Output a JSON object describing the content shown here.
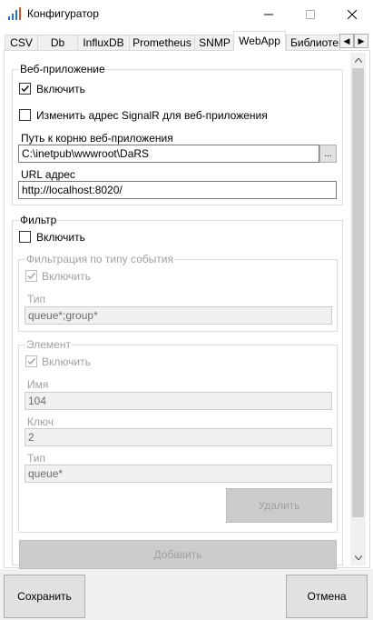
{
  "window": {
    "title": "Конфигуратор",
    "icon": "signal-bars-icon",
    "accent": "#1e6fd9"
  },
  "tabs": [
    {
      "label": "CSV"
    },
    {
      "label": "Db"
    },
    {
      "label": "InfluxDB"
    },
    {
      "label": "Prometheus"
    },
    {
      "label": "SNMP"
    },
    {
      "label": "WebApp",
      "active": true
    },
    {
      "label": "Библиотек"
    }
  ],
  "webapp": {
    "group_title": "Веб-приложение",
    "enable_label": "Включить",
    "enable_checked": true,
    "signalr_label": "Изменить адрес SignalR для веб-приложения",
    "signalr_checked": false,
    "root_path_label": "Путь к корню веб-приложения",
    "root_path_value": "C:\\inetpub\\wwwroot\\DaRS",
    "browse_label": "...",
    "url_label": "URL адрес",
    "url_value": "http://localhost:8020/"
  },
  "filter": {
    "group_title": "Фильтр",
    "enable_label": "Включить",
    "enable_checked": false,
    "event_type": {
      "group_title": "Фильтрация по типу события",
      "enable_label": "Включить",
      "enable_checked": true,
      "type_label": "Тип",
      "type_value": "queue*;group*"
    },
    "element": {
      "group_title": "Элемент",
      "enable_label": "Включить",
      "enable_checked": true,
      "name_label": "Имя",
      "name_value": "104",
      "key_label": "Ключ",
      "key_value": "2",
      "type_label": "Тип",
      "type_value": "queue*",
      "delete_label": "Удалить"
    },
    "add_label": "Добавить"
  },
  "footer": {
    "save_label": "Сохранить",
    "cancel_label": "Отмена"
  }
}
